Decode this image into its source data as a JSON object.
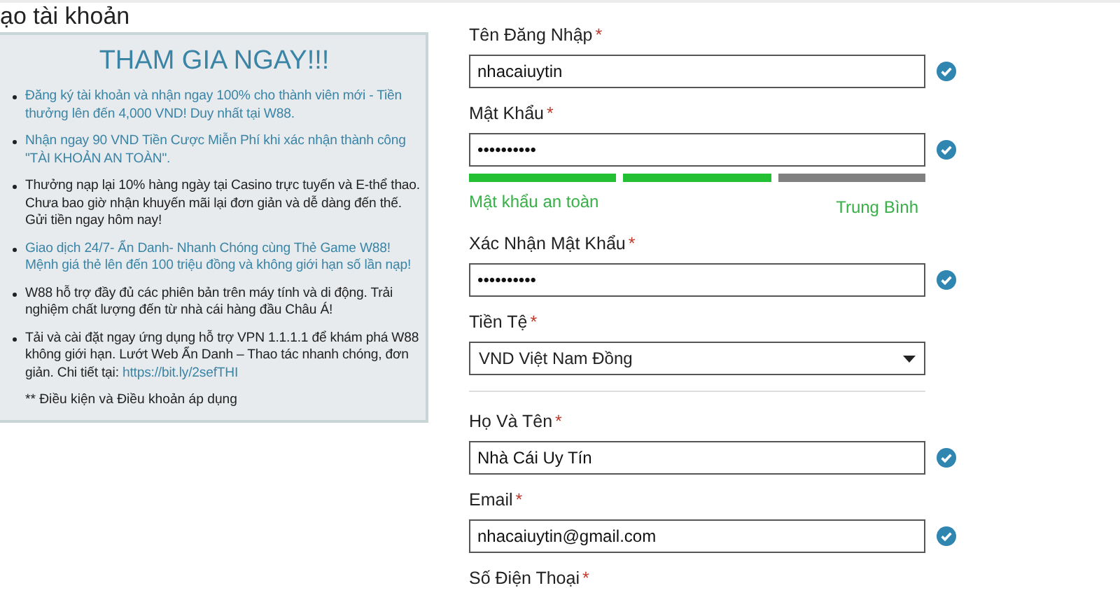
{
  "page_title": "ạo tài khoản",
  "promo": {
    "heading": "THAM GIA NGAY!!!",
    "bullets": [
      {
        "kind": "highlight",
        "text": "Đăng ký tài khoản và nhận ngay 100% cho thành viên mới - Tiền thưởng lên đến 4,000 VND! Duy nhất tại W88."
      },
      {
        "kind": "highlight",
        "text": "Nhận ngay 90 VND Tiền Cược Miễn Phí khi xác nhận thành công \"TÀI KHOẢN AN TOÀN\"."
      },
      {
        "kind": "plain",
        "text": "Thưởng nạp lại 10% hàng ngày tại Casino trực tuyến và E-thể thao. Chưa bao giờ nhận khuyến mãi lại đơn giản và dễ dàng đến thế. Gửi tiền ngay hôm nay!"
      },
      {
        "kind": "highlight",
        "text": "Giao dịch 24/7- Ẩn Danh- Nhanh Chóng cùng Thẻ Game W88! Mệnh giá thẻ lên đến 100 triệu đồng và không giới hạn số lần nạp!"
      },
      {
        "kind": "plain",
        "text": "W88 hỗ trợ đầy đủ các phiên bản trên máy tính và di động. Trải nghiệm chất lượng đến từ nhà cái hàng đầu Châu Á!"
      },
      {
        "kind": "plain",
        "text": "Tải và cài đặt ngay ứng dụng hỗ trợ VPN 1.1.1.1 để khám phá W88 không giới hạn. Lướt Web Ẩn Danh – Thao tác nhanh chóng, đơn giản. Chi tiết tại: ",
        "link": "https://bit.ly/2sefTHI"
      }
    ],
    "terms": "** Điều kiện và Điều khoản áp dụng"
  },
  "form": [
    {
      "kind": "text",
      "label": "Tên Đăng Nhập",
      "required": "*",
      "value": "nhacaiuytin",
      "valid": true
    },
    {
      "kind": "text",
      "label": "Mật Khẩu",
      "required": "*",
      "value": "••••••••••",
      "valid": true
    },
    {
      "kind": "strength",
      "segments": [
        {
          "on": true
        },
        {
          "on": true
        },
        {
          "on": false
        }
      ],
      "caption": "Mật khẩu an toàn",
      "rating": "Trung Bình"
    },
    {
      "kind": "text",
      "label": "Xác Nhận Mật Khẩu",
      "required": "*",
      "value": "••••••••••",
      "valid": true
    },
    {
      "kind": "select",
      "label": "Tiền Tệ",
      "required": "*",
      "value": "VND Việt Nam Đồng"
    },
    {
      "kind": "divider"
    },
    {
      "kind": "text",
      "label": "Họ Và Tên",
      "required": "*",
      "value": "Nhà Cái Uy Tín",
      "valid": true
    },
    {
      "kind": "text",
      "label": "Email",
      "required": "*",
      "value": "nhacaiuytin@gmail.com",
      "valid": true
    },
    {
      "kind": "label",
      "label": "Số Điện Thoại",
      "required": "*"
    }
  ]
}
